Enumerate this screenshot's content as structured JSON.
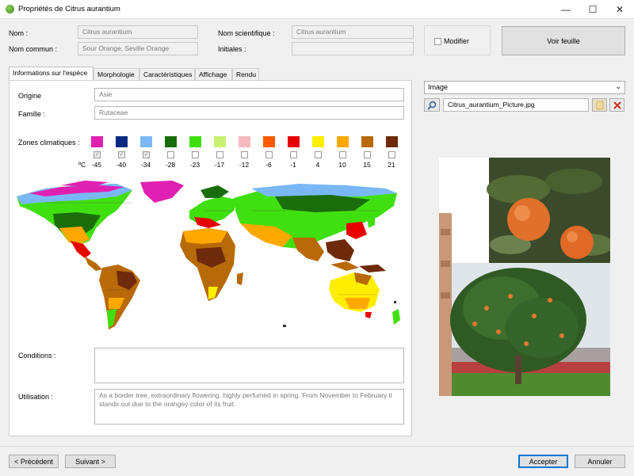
{
  "window": {
    "title": "Propriétés de Citrus aurantium",
    "minimize": "—",
    "maximize": "☐",
    "close": "✕"
  },
  "header": {
    "nom_label": "Nom :",
    "nom_value": "Citrus aurantium",
    "nom_commun_label": "Nom commun :",
    "nom_commun_value": "Sour Orange, Seville Orange",
    "nom_scientifique_label": "Nom scientifique :",
    "nom_scientifique_value": "Citrus aurantium",
    "initiales_label": "Initiales :",
    "initiales_value": "",
    "modifier_label": "Modifier",
    "voir_feuille_label": "Voir feuille"
  },
  "tabs": [
    {
      "label": "Informations sur l'espèce",
      "active": true
    },
    {
      "label": "Morphologie",
      "active": false
    },
    {
      "label": "Caractéristiques",
      "active": false
    },
    {
      "label": "Affichage",
      "active": false
    },
    {
      "label": "Rendu",
      "active": false
    }
  ],
  "info": {
    "origine_label": "Origine",
    "origine_value": "Asie",
    "famille_label": "Famille :",
    "famille_value": "Rutaceae",
    "zones_label": "Zones climatiques :",
    "unit_label": "ºC",
    "zones": [
      {
        "temp": "-45",
        "color": "#e020b0",
        "checked": true
      },
      {
        "temp": "-40",
        "color": "#0a2a80",
        "checked": true
      },
      {
        "temp": "-34",
        "color": "#7ab8f5",
        "checked": true
      },
      {
        "temp": "-28",
        "color": "#1a6e0a",
        "checked": false
      },
      {
        "temp": "-23",
        "color": "#40e010",
        "checked": false
      },
      {
        "temp": "-17",
        "color": "#c8f070",
        "checked": false
      },
      {
        "temp": "-12",
        "color": "#f8b8c0",
        "checked": false
      },
      {
        "temp": "-6",
        "color": "#ff5a00",
        "checked": false
      },
      {
        "temp": "-1",
        "color": "#e80000",
        "checked": false
      },
      {
        "temp": "4",
        "color": "#ffee00",
        "checked": false
      },
      {
        "temp": "10",
        "color": "#ffa800",
        "checked": false
      },
      {
        "temp": "15",
        "color": "#b86a08",
        "checked": false
      },
      {
        "temp": "21",
        "color": "#6e2a0a",
        "checked": false
      }
    ],
    "conditions_label": "Conditions :",
    "conditions_value": "",
    "utilisation_label": "Utilisation :",
    "utilisation_value": "As a border tree, extraordinary flowering, highly perfumed in spring. From November to February it stands out due to the orangey color of its fruit."
  },
  "image_panel": {
    "combo_value": "Image",
    "file_name": "Citrus_aurantium_Picture.jpg",
    "search_icon": "magnifier-icon",
    "folder_icon": "folder-icon",
    "delete_icon": "delete-icon"
  },
  "footer": {
    "prev_label": "< Précédent",
    "next_label": "Suivant >",
    "accept_label": "Accepter",
    "cancel_label": "Annuler"
  }
}
